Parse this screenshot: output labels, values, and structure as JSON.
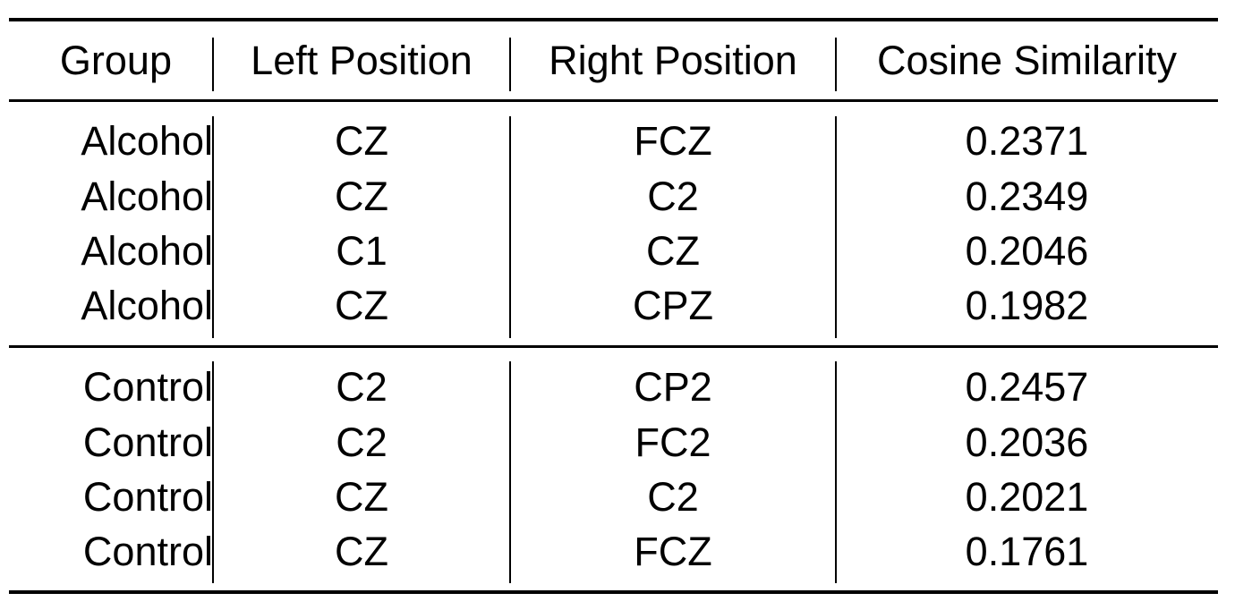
{
  "table": {
    "columns": [
      "Group",
      "Left Position",
      "Right Position",
      "Cosine Similarity"
    ],
    "sections": [
      {
        "rows": [
          [
            "Alcohol",
            "CZ",
            "FCZ",
            "0.2371"
          ],
          [
            "Alcohol",
            "CZ",
            "C2",
            "0.2349"
          ],
          [
            "Alcohol",
            "C1",
            "CZ",
            "0.2046"
          ],
          [
            "Alcohol",
            "CZ",
            "CPZ",
            "0.1982"
          ]
        ]
      },
      {
        "rows": [
          [
            "Control",
            "C2",
            "CP2",
            "0.2457"
          ],
          [
            "Control",
            "C2",
            "FC2",
            "0.2036"
          ],
          [
            "Control",
            "CZ",
            "C2",
            "0.2021"
          ],
          [
            "Control",
            "CZ",
            "FCZ",
            "0.1761"
          ]
        ]
      }
    ]
  }
}
